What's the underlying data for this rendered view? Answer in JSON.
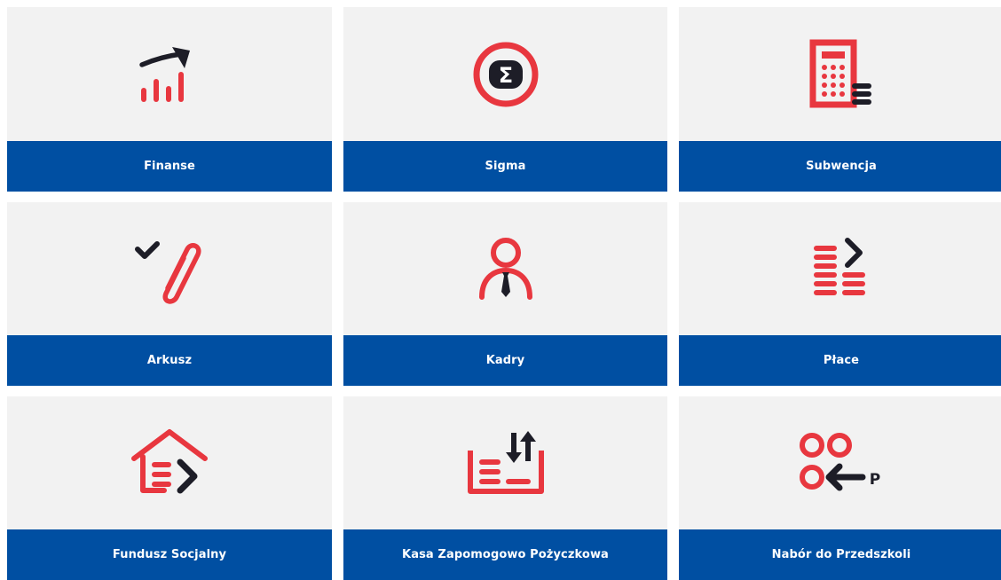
{
  "colors": {
    "tile_background": "#f2f2f2",
    "label_bar": "#004fa2",
    "label_text": "#ffffff",
    "icon_accent": "#e8373f",
    "icon_dark": "#1d1d27"
  },
  "tiles": [
    {
      "id": "finanse",
      "label": "Finanse",
      "icon": "finance-chart-icon"
    },
    {
      "id": "sigma",
      "label": "Sigma",
      "icon": "sigma-icon"
    },
    {
      "id": "subwencja",
      "label": "Subwencja",
      "icon": "calculator-icon"
    },
    {
      "id": "arkusz",
      "label": "Arkusz",
      "icon": "paperclip-check-icon"
    },
    {
      "id": "kadry",
      "label": "Kadry",
      "icon": "person-tie-icon"
    },
    {
      "id": "place",
      "label": "Płace",
      "icon": "coin-stacks-icon"
    },
    {
      "id": "fundusz-socjalny",
      "label": "Fundusz Socjalny",
      "icon": "house-arrow-icon"
    },
    {
      "id": "kasa",
      "label": "Kasa Zapomogowo Pożyczkowa",
      "icon": "box-transfer-icon"
    },
    {
      "id": "nabor",
      "label": "Nabór do Przedszkoli",
      "icon": "circles-arrow-icon"
    }
  ],
  "icon_text": {
    "sigma": "Σ",
    "preschool_letter": "P"
  }
}
